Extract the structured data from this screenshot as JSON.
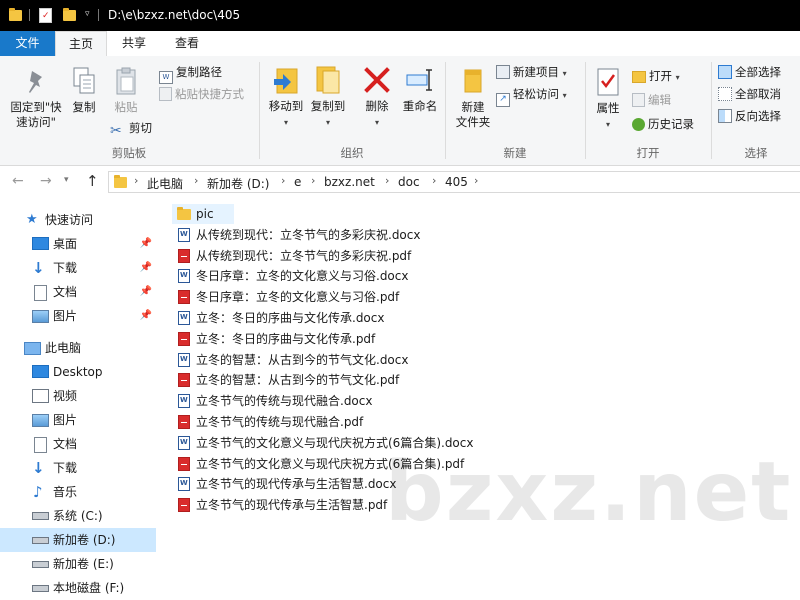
{
  "window": {
    "title_path": "D:\\e\\bzxz.net\\doc\\405"
  },
  "tabs": {
    "file": "文件",
    "home": "主页",
    "share": "共享",
    "view": "查看"
  },
  "ribbon": {
    "clipboard": {
      "pin_label_1": "固定到\"快",
      "pin_label_2": "速访问\"",
      "copy": "复制",
      "paste": "粘贴",
      "copy_path": "复制路径",
      "paste_shortcut": "粘贴快捷方式",
      "cut": "剪切",
      "group": "剪贴板"
    },
    "organize": {
      "move_to": "移动到",
      "copy_to": "复制到",
      "delete": "删除",
      "rename": "重命名",
      "group": "组织"
    },
    "new": {
      "new_folder_1": "新建",
      "new_folder_2": "文件夹",
      "new_item": "新建项目",
      "easy_access": "轻松访问",
      "group": "新建"
    },
    "open": {
      "properties": "属性",
      "open": "打开",
      "edit": "编辑",
      "history": "历史记录",
      "group": "打开"
    },
    "select": {
      "select_all": "全部选择",
      "select_none": "全部取消",
      "invert": "反向选择",
      "group": "选择"
    }
  },
  "address": {
    "crumbs": [
      "此电脑",
      "新加卷 (D:)",
      "e",
      "bzxz.net",
      "doc",
      "405"
    ]
  },
  "nav": {
    "quick_access": "快速访问",
    "qa_items": [
      "桌面",
      "下载",
      "文档",
      "图片"
    ],
    "this_pc": "此电脑",
    "pc_items": [
      "Desktop",
      "视频",
      "图片",
      "文档",
      "下载",
      "音乐",
      "系统 (C:)",
      "新加卷 (D:)",
      "新加卷 (E:)",
      "本地磁盘 (F:)"
    ]
  },
  "files": [
    {
      "name": "pic",
      "type": "folder"
    },
    {
      "name": "从传统到现代：立冬节气的多彩庆祝.docx",
      "type": "docx"
    },
    {
      "name": "从传统到现代：立冬节气的多彩庆祝.pdf",
      "type": "pdf"
    },
    {
      "name": "冬日序章：立冬的文化意义与习俗.docx",
      "type": "docx"
    },
    {
      "name": "冬日序章：立冬的文化意义与习俗.pdf",
      "type": "pdf"
    },
    {
      "name": "立冬：冬日的序曲与文化传承.docx",
      "type": "docx"
    },
    {
      "name": "立冬：冬日的序曲与文化传承.pdf",
      "type": "pdf"
    },
    {
      "name": "立冬的智慧：从古到今的节气文化.docx",
      "type": "docx"
    },
    {
      "name": "立冬的智慧：从古到今的节气文化.pdf",
      "type": "pdf"
    },
    {
      "name": "立冬节气的传统与现代融合.docx",
      "type": "docx"
    },
    {
      "name": "立冬节气的传统与现代融合.pdf",
      "type": "pdf"
    },
    {
      "name": "立冬节气的文化意义与现代庆祝方式(6篇合集).docx",
      "type": "docx"
    },
    {
      "name": "立冬节气的文化意义与现代庆祝方式(6篇合集).pdf",
      "type": "pdf"
    },
    {
      "name": "立冬节气的现代传承与生活智慧.docx",
      "type": "docx"
    },
    {
      "name": "立冬节气的现代传承与生活智慧.pdf",
      "type": "pdf"
    }
  ],
  "watermark": "bzxz.net",
  "colors": {
    "accent": "#1979ca",
    "folder": "#f4c542",
    "selection": "#cce8ff",
    "pdf": "#d92c2c",
    "word": "#2b5797"
  }
}
